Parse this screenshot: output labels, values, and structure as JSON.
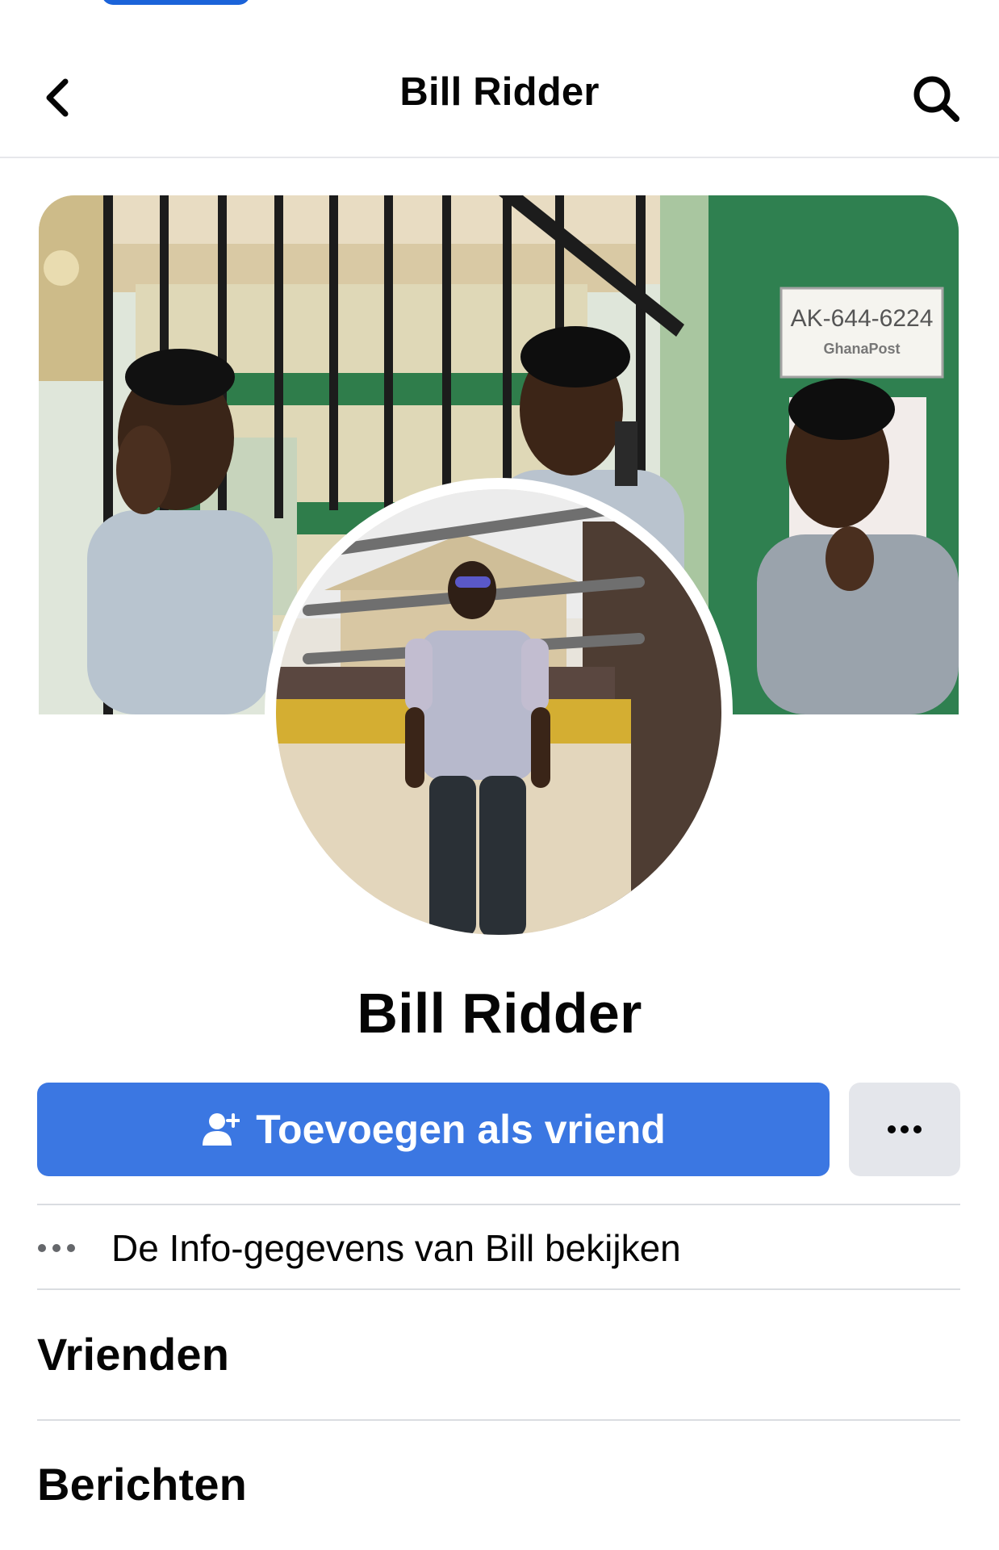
{
  "header": {
    "title": "Bill Ridder",
    "back_icon": "chevron-left-icon",
    "search_icon": "search-icon"
  },
  "cover_photo": {
    "sign_number": "AK-644-6224",
    "sign_brand": "GhanaPost"
  },
  "profile": {
    "name": "Bill Ridder"
  },
  "actions": {
    "add_friend_label": "Toevoegen als vriend",
    "add_friend_icon": "person-add-icon",
    "more_icon": "more-dots-icon"
  },
  "info": {
    "label": "De Info-gegevens van Bill bekijken",
    "icon": "more-dots-icon"
  },
  "sections": {
    "friends": "Vrienden",
    "posts": "Berichten"
  },
  "colors": {
    "primary": "#3b77e2",
    "secondary_button": "#e4e6eb",
    "divider": "#dadde1",
    "text": "#050505"
  }
}
